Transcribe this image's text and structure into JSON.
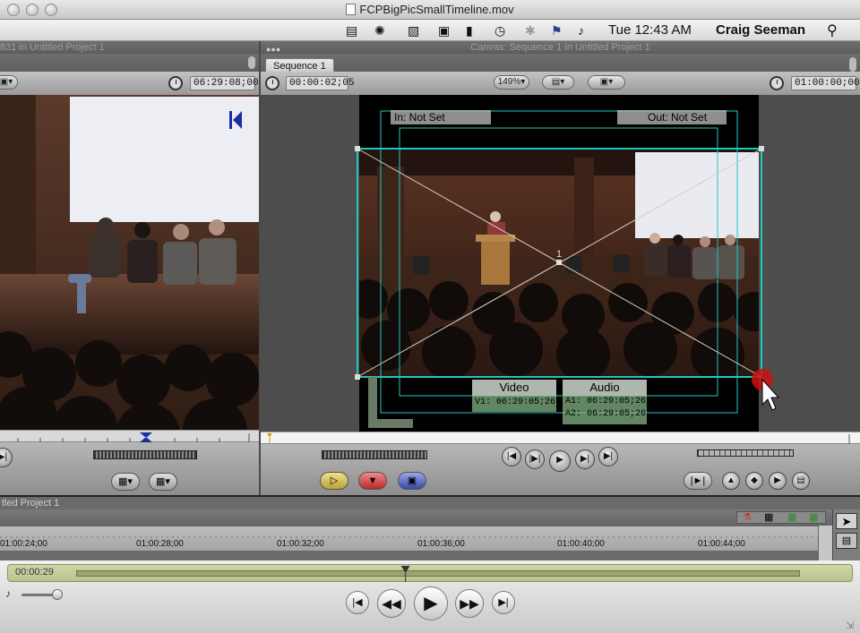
{
  "window": {
    "title": "FCPBigPicSmallTimeline.mov"
  },
  "menubar": {
    "clock": "Tue 12:43 AM",
    "user": "Craig Seeman"
  },
  "viewer": {
    "title": "831 in Untitled Project 1",
    "timecode": "06:29:08;00"
  },
  "canvas": {
    "title": "Canvas: Sequence 1 in Untitled Project 1",
    "tab": "Sequence 1",
    "current_timecode": "00:00:02;05",
    "zoom": "149%",
    "duration_timecode": "01:00:00;00",
    "in_label": "In: Not Set",
    "out_label": "Out: Not Set",
    "video_label": "Video",
    "video_tc": "V1: 06:29:05;26",
    "audio_label": "Audio",
    "audio_a1": "A1: 06:29:05;26",
    "audio_a2": "A2: 06:29:05;26",
    "center_mark": "1"
  },
  "timeline": {
    "title": "tled Project 1",
    "ruler": [
      "01:00:24;00",
      "01:00:28;00",
      "01:00:32;00",
      "01:00:36;00",
      "01:00:40;00",
      "01:00:44;00"
    ]
  },
  "quicktime": {
    "time": "00:00:29",
    "playhead_progress": 0.455
  },
  "colors": {
    "overlay_cyan": "#22c7c0",
    "qt_bar": "#c4cf97"
  }
}
